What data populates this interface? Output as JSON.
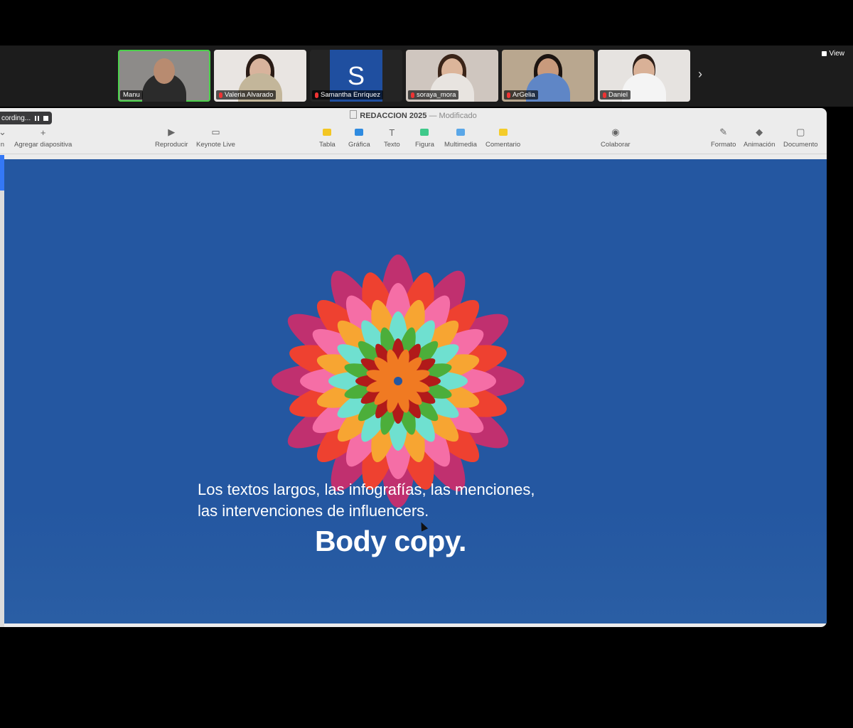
{
  "meeting": {
    "view_label": "View",
    "participants": [
      {
        "name": "Manu",
        "active": true,
        "muted": false
      },
      {
        "name": "Valeria Alvarado",
        "muted": true
      },
      {
        "name": "Samantha Enríquez",
        "muted": true,
        "avatar_letter": "S"
      },
      {
        "name": "soraya_mora",
        "muted": true
      },
      {
        "name": "ArGelia",
        "muted": true
      },
      {
        "name": "Daniel",
        "muted": true
      }
    ],
    "recording_label": "cording..."
  },
  "keynote": {
    "window_title": "REDACCION 2025",
    "title_separator": "—",
    "window_status": "Modificado",
    "toolbar": {
      "left_cut": "n",
      "add_slide": "Agregar diapositiva",
      "play": "Reproducir",
      "keynote_live": "Keynote Live",
      "table": "Tabla",
      "chart": "Gráfica",
      "text": "Texto",
      "shape": "Figura",
      "media": "Multimedia",
      "comment": "Comentario",
      "collaborate": "Colaborar",
      "format": "Formato",
      "animate": "Animación",
      "document": "Documento"
    }
  },
  "slide": {
    "body_line1": "Los textos largos, las infografías, las menciones,",
    "body_line2": "las intervenciones de influencers.",
    "title": "Body copy.",
    "colors": {
      "background": "#2457a1",
      "flower_layers": [
        "#c0306f",
        "#ee4130",
        "#f56ea6",
        "#f7a532",
        "#6fe0d0",
        "#4cae3a",
        "#b11a1a",
        "#f07a22"
      ],
      "center": "#2457a1"
    }
  }
}
